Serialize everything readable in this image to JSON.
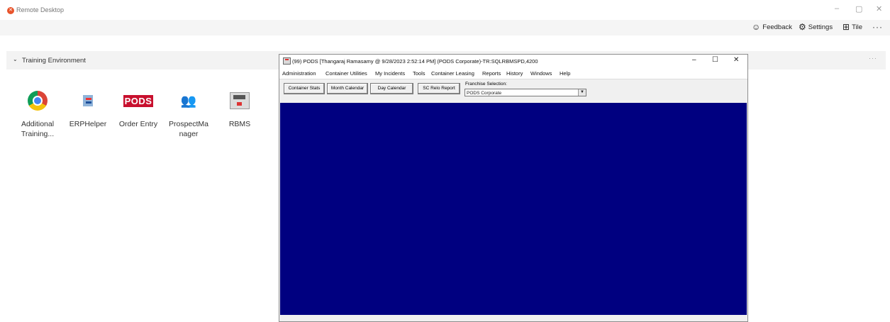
{
  "app": {
    "title": "Remote Desktop",
    "icon_color": "#e8532b"
  },
  "window_controls": {
    "minimize": "–",
    "maximize": "▢",
    "close": "✕"
  },
  "toolbar": {
    "feedback_label": "Feedback",
    "settings_label": "Settings",
    "tile_label": "Tile",
    "more_label": "···"
  },
  "environment": {
    "label": "Training Environment",
    "more_label": "···"
  },
  "tiles": [
    {
      "label": "Additional Training...",
      "icon": "chrome-icon"
    },
    {
      "label": "ERPHelper",
      "icon": "erphelper-icon"
    },
    {
      "label": "Order Entry",
      "icon": "pods-icon",
      "icon_text": "PODS"
    },
    {
      "label": "ProspectMa nager",
      "icon": "people-icon"
    },
    {
      "label": "RBMS",
      "icon": "rbms-icon"
    }
  ],
  "pods_window": {
    "title": "(99) PODS    [Thangaraj Ramasamy @ 9/28/2023 2:52:14 PM]  (PODS Corporate)-TR:SQLRBMSPD,4200",
    "controls": {
      "minimize": "–",
      "maximize": "☐",
      "close": "✕"
    },
    "menu": [
      "Administration",
      "Container Utilities",
      "My Incidents",
      "Tools",
      "Container Leasing",
      "Reports",
      "History",
      "Windows",
      "Help"
    ],
    "buttons": [
      "Container Stats",
      "Month Calendar",
      "Day Calendar",
      "SC Relo Report"
    ],
    "franchise_label": "Franchise Selection:",
    "franchise_value": "PODS Corporate",
    "canvas_color": "#000080"
  }
}
